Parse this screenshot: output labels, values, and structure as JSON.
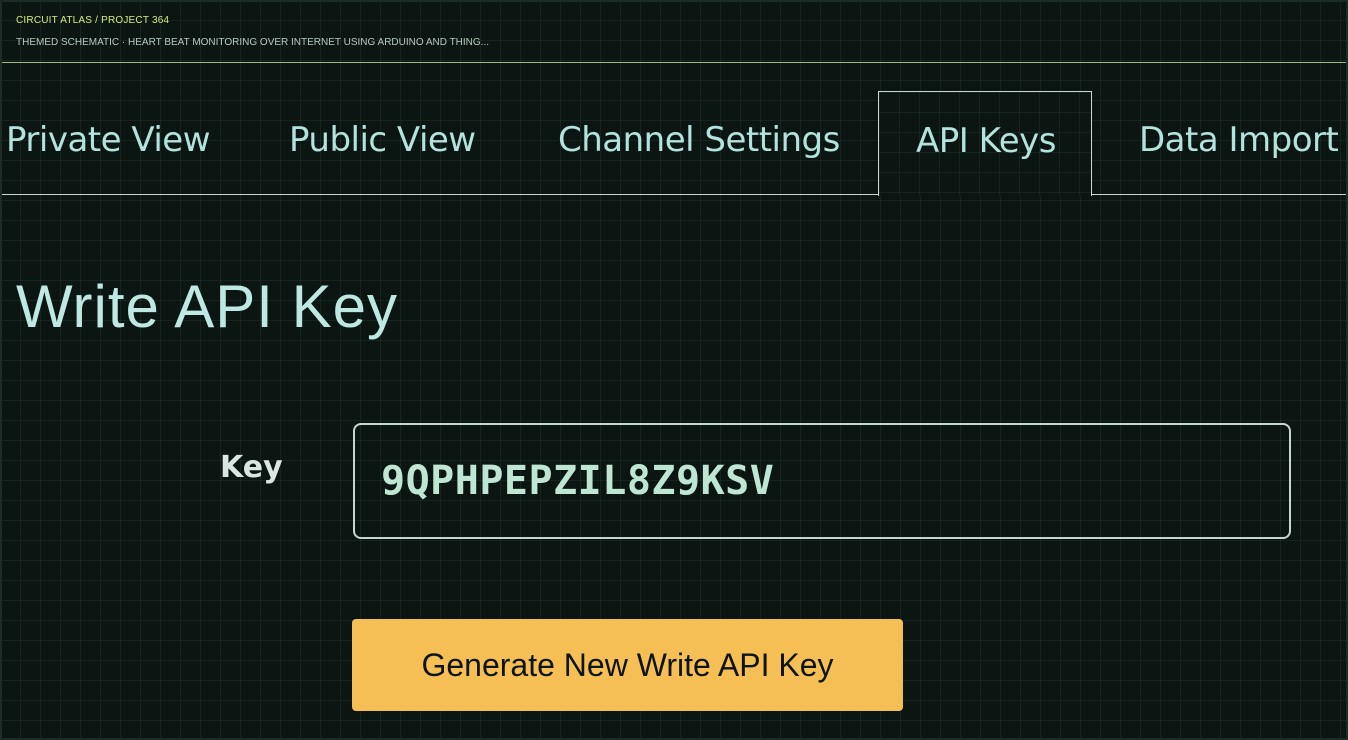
{
  "header": {
    "breadcrumb": "CIRCUIT ATLAS / PROJECT 364",
    "subtitle": "THEMED SCHEMATIC · HEART BEAT MONITORING OVER INTERNET USING ARDUINO AND THING..."
  },
  "tabs": {
    "private": "Private View",
    "public": "Public View",
    "settings": "Channel Settings",
    "api_keys": "API Keys",
    "import": "Data Import /",
    "active": "API Keys"
  },
  "section": {
    "title": "Write API Key"
  },
  "key_field": {
    "label": "Key",
    "value": "9QPHPEPZIL8Z9KSV"
  },
  "actions": {
    "generate_label": "Generate New Write API Key"
  },
  "colors": {
    "background": "#0b1512",
    "accent_button": "#f5bf55",
    "breadcrumb": "#d8ec7a",
    "tab_text": "#b4e3de"
  }
}
